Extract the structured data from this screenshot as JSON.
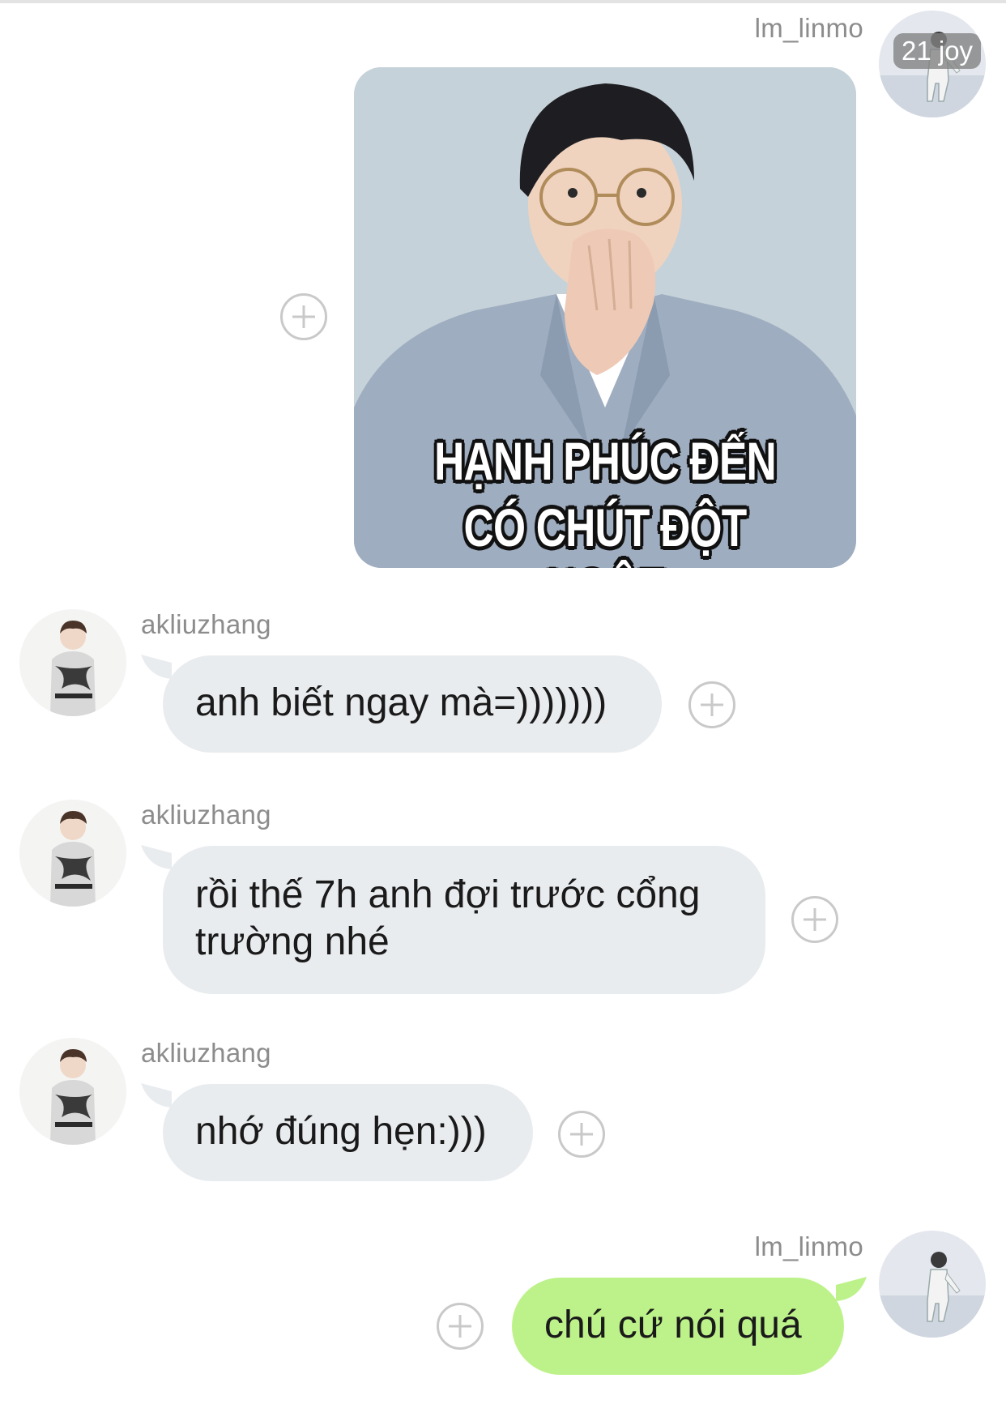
{
  "colors": {
    "background": "#ffffff",
    "received_bubble": "#e9ecef",
    "sent_bubble": "#bdf28a",
    "username": "#8c8c8c",
    "plus_icon": "#c9c9c9"
  },
  "messages": [
    {
      "sender": "lm_linmo",
      "side": "right",
      "avatar_badge": "21 joy",
      "type": "sticker",
      "caption_line1": "HẠNH PHÚC ĐẾN",
      "caption_line2": "CÓ CHÚT ĐỘT NGỘT"
    },
    {
      "sender": "akliuzhang",
      "side": "left",
      "type": "text",
      "text": "anh biết ngay mà=)))))))"
    },
    {
      "sender": "akliuzhang",
      "side": "left",
      "type": "text",
      "text_line1": "rồi thế 7h anh đợi trước cổng",
      "text_line2": "trường nhé"
    },
    {
      "sender": "akliuzhang",
      "side": "left",
      "type": "text",
      "text": "nhớ đúng hẹn:)))"
    },
    {
      "sender": "lm_linmo",
      "side": "right",
      "type": "text",
      "text": "chú cứ nói quá"
    }
  ]
}
